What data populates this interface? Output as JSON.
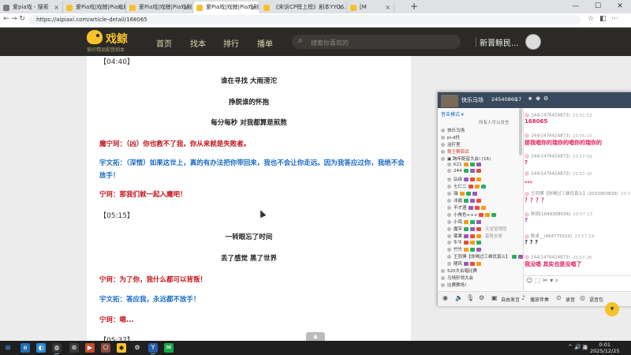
{
  "browser": {
    "tabs": [
      {
        "label": "爱pia戏 - 搜索",
        "color": "#7b7b7b"
      },
      {
        "label": "爱Pia戏|戏鲸|Pia戏剧本网,广播剧...",
        "color": "#f6c22c"
      },
      {
        "label": "爱Pia戏|戏鲸|Pia戏剧本网,广播剧...",
        "color": "#f6c22c"
      },
      {
        "label": "爱Pia戏|戏鲸|Pia戏剧本网,广播剧...",
        "color": "#f6c22c"
      },
      {
        "label": "《宋诉CP榜上榜》剧本YYOS...",
        "color": "#f6c22c"
      },
      {
        "label": "[M",
        "color": "#f6c22c"
      }
    ],
    "url": "https://aipiaxi.com/article-detail/168065",
    "new_tab": "+",
    "win_min": "—",
    "win_max": "☐",
    "win_close": "✕",
    "back": "←",
    "forward": "→",
    "reload": "↻"
  },
  "site": {
    "brand": "戏鲸",
    "slogan": "爱好精品配音剧本",
    "nav": [
      "首页",
      "找本",
      "排行",
      "播单"
    ],
    "search_placeholder": "搜索你喜欢的",
    "username": "新晋鲸民...",
    "search_icon": "⌕"
  },
  "article": {
    "lines": [
      {
        "type": "time",
        "text": "【04:40】"
      },
      {
        "type": "center",
        "text": "谁在寻找 大雨滂沱"
      },
      {
        "type": "center",
        "text": "挣脱谁的怀抱"
      },
      {
        "type": "center",
        "text": "每分每秒 对我都算是煎熬"
      },
      {
        "type": "red",
        "text": "魔宁珂：（凶）你也救不了我，你从来就是失败者。"
      },
      {
        "type": "blue",
        "text": "宇文拓：（深情）如果这世上，真的有办法把你带回来，我也不会让你走远。因为我答应过你，我绝不会放手！"
      },
      {
        "type": "red",
        "text": "宁珂：那我们就一起入魔吧！"
      },
      {
        "type": "time",
        "text": "【05:15】"
      },
      {
        "type": "center",
        "text": "一转眼忘了时间"
      },
      {
        "type": "center",
        "text": "丢了感觉 黑了世界"
      },
      {
        "type": "red",
        "text": "宁珂：为了你，我什么都可以背叛！"
      },
      {
        "type": "blue",
        "text": "宇文拓：答应我，永远都不放手！"
      },
      {
        "type": "red",
        "text": "宁珂：嗯..."
      },
      {
        "type": "time",
        "text": "【05:37】"
      }
    ]
  },
  "yy": {
    "channel": "快乐马场",
    "channel_id": "24540869",
    "online": "17",
    "left_top": "音击模式 ▾",
    "left_sort": "所有人可以发言",
    "tree": [
      {
        "text": "快乐马场",
        "hl": false
      },
      {
        "text": "pi-d托",
        "hl": false
      },
      {
        "text": "治疗室",
        "hl": false
      },
      {
        "text": "歌王赛调试",
        "hl": true
      },
      {
        "text": "▣ 跨年配音大会! (16)",
        "hl": false
      },
      {
        "text": "K21",
        "hl": false
      },
      {
        "text": "244",
        "hl": false
      },
      {
        "text": "弘绎",
        "hl": false
      },
      {
        "text": "七仁二",
        "hl": false
      },
      {
        "text": "瑞",
        "hl": false
      },
      {
        "text": "冰霜",
        "hl": false
      },
      {
        "text": "不才酒",
        "hl": false
      },
      {
        "text": "小角色+++",
        "hl": false
      },
      {
        "text": "小鸡",
        "hl": false
      },
      {
        "text": "魔芋",
        "hl": false,
        "note": "天堂管理层"
      },
      {
        "text": "菊果",
        "hl": false,
        "note": "基隆吉哥"
      },
      {
        "text": "牛牛",
        "hl": false
      },
      {
        "text": "竹竹",
        "hl": false
      },
      {
        "text": "王同博【你喝过三维优真么】",
        "hl": false
      },
      {
        "text": "随风",
        "hl": false
      },
      {
        "text": "520大合唱比赛",
        "hl": false
      },
      {
        "text": "马场轩领大会",
        "hl": false
      },
      {
        "text": "比赛赛场！",
        "hl": false
      }
    ],
    "messages": [
      {
        "who": "244(1476424873)",
        "time": "23:51:53",
        "body": "168065",
        "color": "#e0245e"
      },
      {
        "who": "244(1476424873)",
        "time": "23:55:10",
        "body": "那我唱你的瑞你的唱你的瑞你的",
        "color": "#e0245e"
      },
      {
        "who": "244(1476424873)",
        "time": "23:57:09",
        "body": "?",
        "color": "#e0245e"
      },
      {
        "who": "244(1476424873)",
        "time": "23:57:10",
        "body": "。。。",
        "color": "#e0245e"
      },
      {
        "who": "王同博【你喝过三维优真么】(2033950839)",
        "time": "23:57:12",
        "body": "？？？？",
        "color": "#e0245e"
      },
      {
        "who": "陈玥(1649308034)",
        "time": "23:57:13",
        "body": "?",
        "color": "#7b3fb8"
      },
      {
        "who": "陈卓__(464775510)",
        "time": "23:57:19",
        "body": "? ? ?",
        "color": "#333333"
      },
      {
        "who": "244(1476424873)",
        "time": "23:57:26",
        "body": "我没唱 其实也是没唱了",
        "color": "#e0245e"
      }
    ],
    "footer": {
      "mic_mode": "自由发言",
      "share": "播放伴奏",
      "record": "录音",
      "bag": "语音包"
    },
    "chat_tools": "☺ ⬚ ✂ ▾ ⌕"
  },
  "taskbar": {
    "time": "0:01",
    "date": "2025/12/25",
    "ime": "英",
    "tray": "^ 🔊 ◉"
  },
  "colors": {
    "header_bg": "#2b2a27",
    "brand": "#f6c22c",
    "red_role": "#c0151b",
    "blue_role": "#1a6cc4"
  }
}
